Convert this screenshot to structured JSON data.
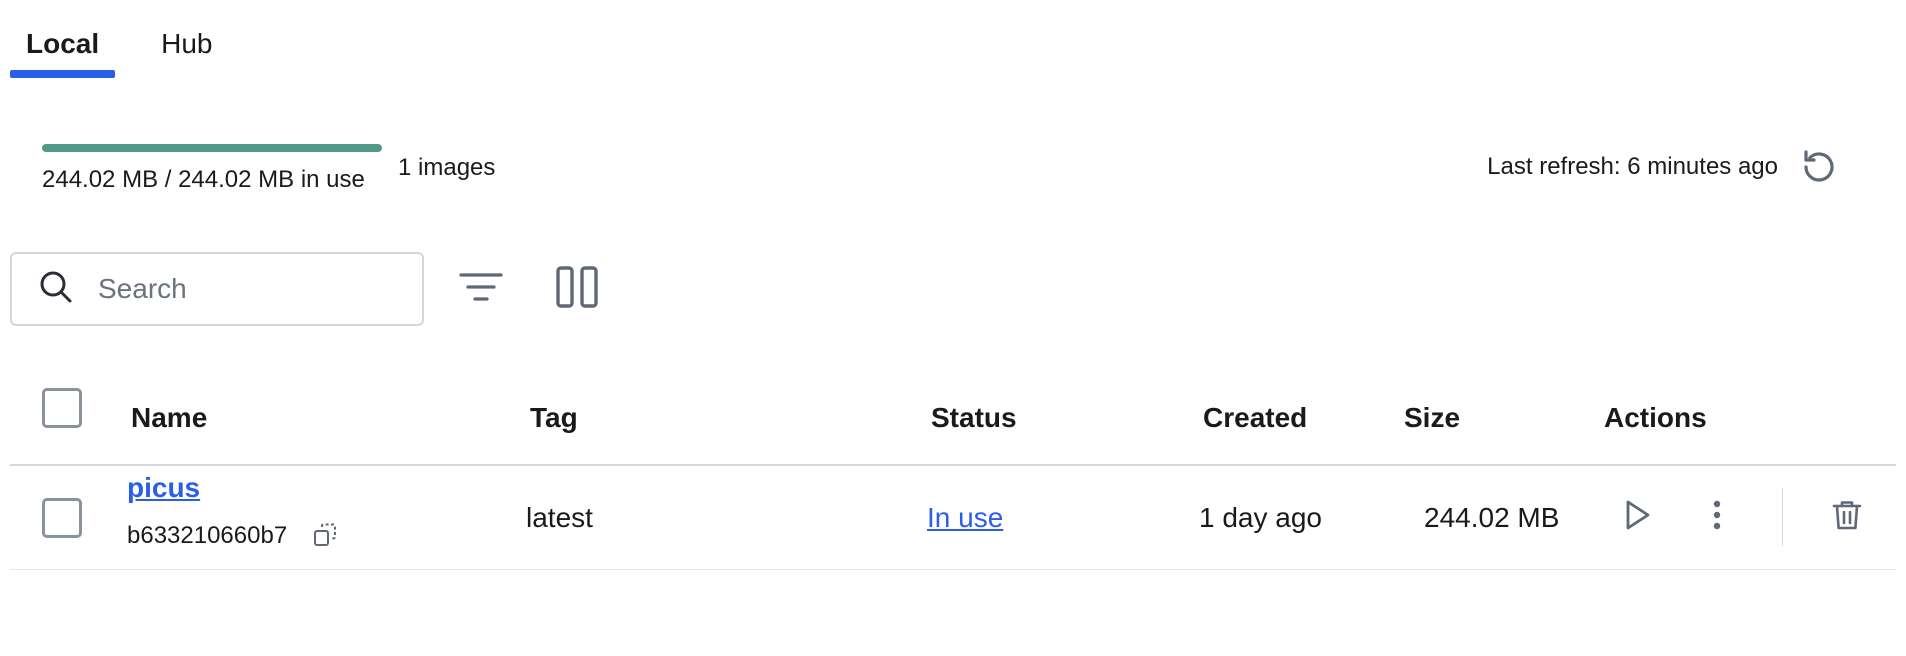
{
  "tabs": [
    {
      "label": "Local",
      "active": true
    },
    {
      "label": "Hub",
      "active": false
    }
  ],
  "usage": {
    "text": "244.02 MB / 244.02 MB in use",
    "fill_fraction": 1.0,
    "bar_color": "#4e9a86"
  },
  "image_count": "1 images",
  "refresh": {
    "text": "Last refresh: 6 minutes ago",
    "icon": "refresh-icon"
  },
  "toolbar": {
    "search_placeholder": "Search",
    "search_icon": "search-icon",
    "filter_icon": "filter-icon",
    "columns_icon": "columns-icon"
  },
  "table": {
    "columns": [
      "Name",
      "Tag",
      "Status",
      "Created",
      "Size",
      "Actions"
    ],
    "rows": [
      {
        "name": "picus",
        "id": "b633210660b7",
        "tag": "latest",
        "status": "In use",
        "created": "1 day ago",
        "size": "244.02 MB",
        "actions": [
          "play-icon",
          "more-vertical-icon",
          "trash-icon"
        ]
      }
    ]
  },
  "colors": {
    "accent": "#2b5ee8",
    "usage_bar": "#4e9a86",
    "icon": "#5f6877"
  }
}
